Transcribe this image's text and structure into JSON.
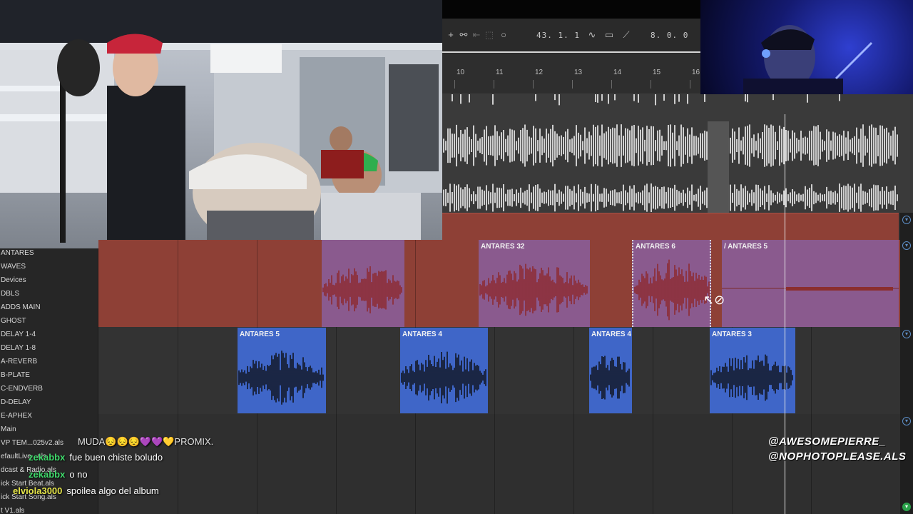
{
  "transport": {
    "position": "43. 1. 1",
    "loop_length": "8. 0. 0"
  },
  "ruler": {
    "ticks": [
      "10",
      "11",
      "12",
      "13",
      "14",
      "15",
      "16"
    ]
  },
  "tracks": [
    "ANTARES",
    "WAVES",
    "Devices",
    "DBLS",
    "ADDS MAIN",
    "GHOST",
    "DELAY 1-4",
    "DELAY 1-8",
    "A-REVERB",
    "B-PLATE",
    "C-ENDVERB",
    "D-DELAY",
    "E-APHEX",
    "Main",
    "VP TEM...025v2.als",
    "efaultLive...als",
    "dcast & Radio.als",
    "ick Start Beat.als",
    "ick Start Song.als",
    "t V1.als"
  ],
  "clips_top": [
    {
      "title": ""
    },
    {
      "title": "ANTARES 32"
    },
    {
      "title": "ANTARES 6"
    },
    {
      "title": "/ ANTARES 5"
    }
  ],
  "clips_bottom": [
    {
      "title": "ANTARES 5"
    },
    {
      "title": "ANTARES 4"
    },
    {
      "title": "ANTARES 4"
    },
    {
      "title": "ANTARES 3"
    }
  ],
  "chat": [
    {
      "user": "",
      "message": "MUDA😔😔😔💜💜💛PROMIX.",
      "color": "#8b6fb3"
    },
    {
      "user": "zekabbx",
      "message": "fue buen chiste boludo",
      "color": "#3fd86b"
    },
    {
      "user": "zekabbx",
      "message": "o no",
      "color": "#3fd86b"
    },
    {
      "user": "elviola3000",
      "message": "spoilea algo del album",
      "color": "#e6e64a"
    }
  ],
  "handles": [
    "@AWESOMEPIERRE_",
    "@NOPHOTOPLEASE.ALS"
  ],
  "colors": {
    "clip_red": "#8e4036",
    "clip_purple": "#8a5a8e",
    "clip_blue": "#3f66c8",
    "accent": "#5d8ec7"
  },
  "icons": [
    "plus-icon",
    "link-icon",
    "back-icon",
    "loop-icon",
    "record-icon",
    "curve-icon",
    "monitor-icon",
    "ramp-icon"
  ]
}
